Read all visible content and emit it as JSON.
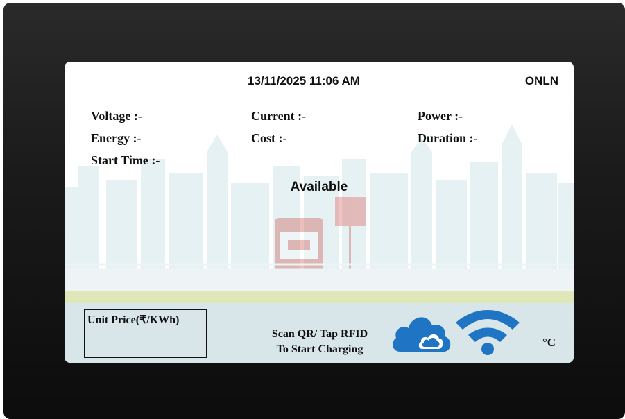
{
  "header": {
    "datetime": "13/11/2025 11:06 AM",
    "connection_status": "ONLN"
  },
  "metrics": {
    "voltage_label": "Voltage :-",
    "current_label": "Current :-",
    "power_label": "Power :-",
    "energy_label": "Energy :-",
    "cost_label": "Cost :-",
    "duration_label": "Duration :-",
    "start_time_label": "Start Time :-"
  },
  "status": {
    "charger_state": "Available"
  },
  "footer": {
    "unit_price_label": "Unit Price(₹/KWh)",
    "scan_line1": "Scan QR/ Tap RFID",
    "scan_line2": "To Start Charging",
    "temperature_unit": "°C"
  },
  "icons": {
    "cloud": "cloud-icon",
    "wifi": "wifi-icon"
  },
  "colors": {
    "icon_blue": "#1f74c4",
    "bottom_band": "#d9e6e9",
    "road_strip": "#dfe7b8"
  }
}
